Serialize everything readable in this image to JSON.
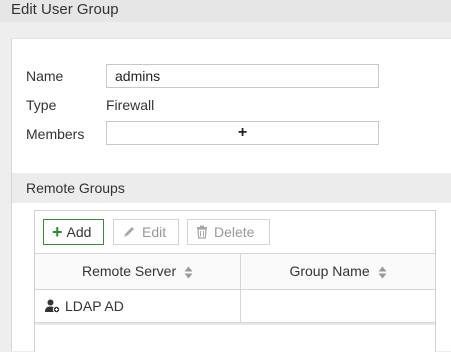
{
  "header": {
    "title": "Edit User Group"
  },
  "form": {
    "name_label": "Name",
    "name_value": "admins",
    "type_label": "Type",
    "type_value": "Firewall",
    "members_label": "Members",
    "members_add_glyph": "+"
  },
  "remote_groups": {
    "section_title": "Remote Groups",
    "toolbar": {
      "add_label": "Add",
      "add_icon": "plus-icon",
      "edit_label": "Edit",
      "edit_icon": "pencil-icon",
      "delete_label": "Delete",
      "delete_icon": "trash-icon"
    },
    "columns": [
      "Remote Server",
      "Group Name"
    ],
    "rows": [
      {
        "remote_server": "LDAP AD",
        "group_name": "",
        "icon": "user-server-icon"
      }
    ]
  },
  "colors": {
    "accent_green": "#2e8b2e",
    "header_bg": "#e6e6e6",
    "section_bg": "#ececec",
    "disabled_text": "#999999"
  }
}
